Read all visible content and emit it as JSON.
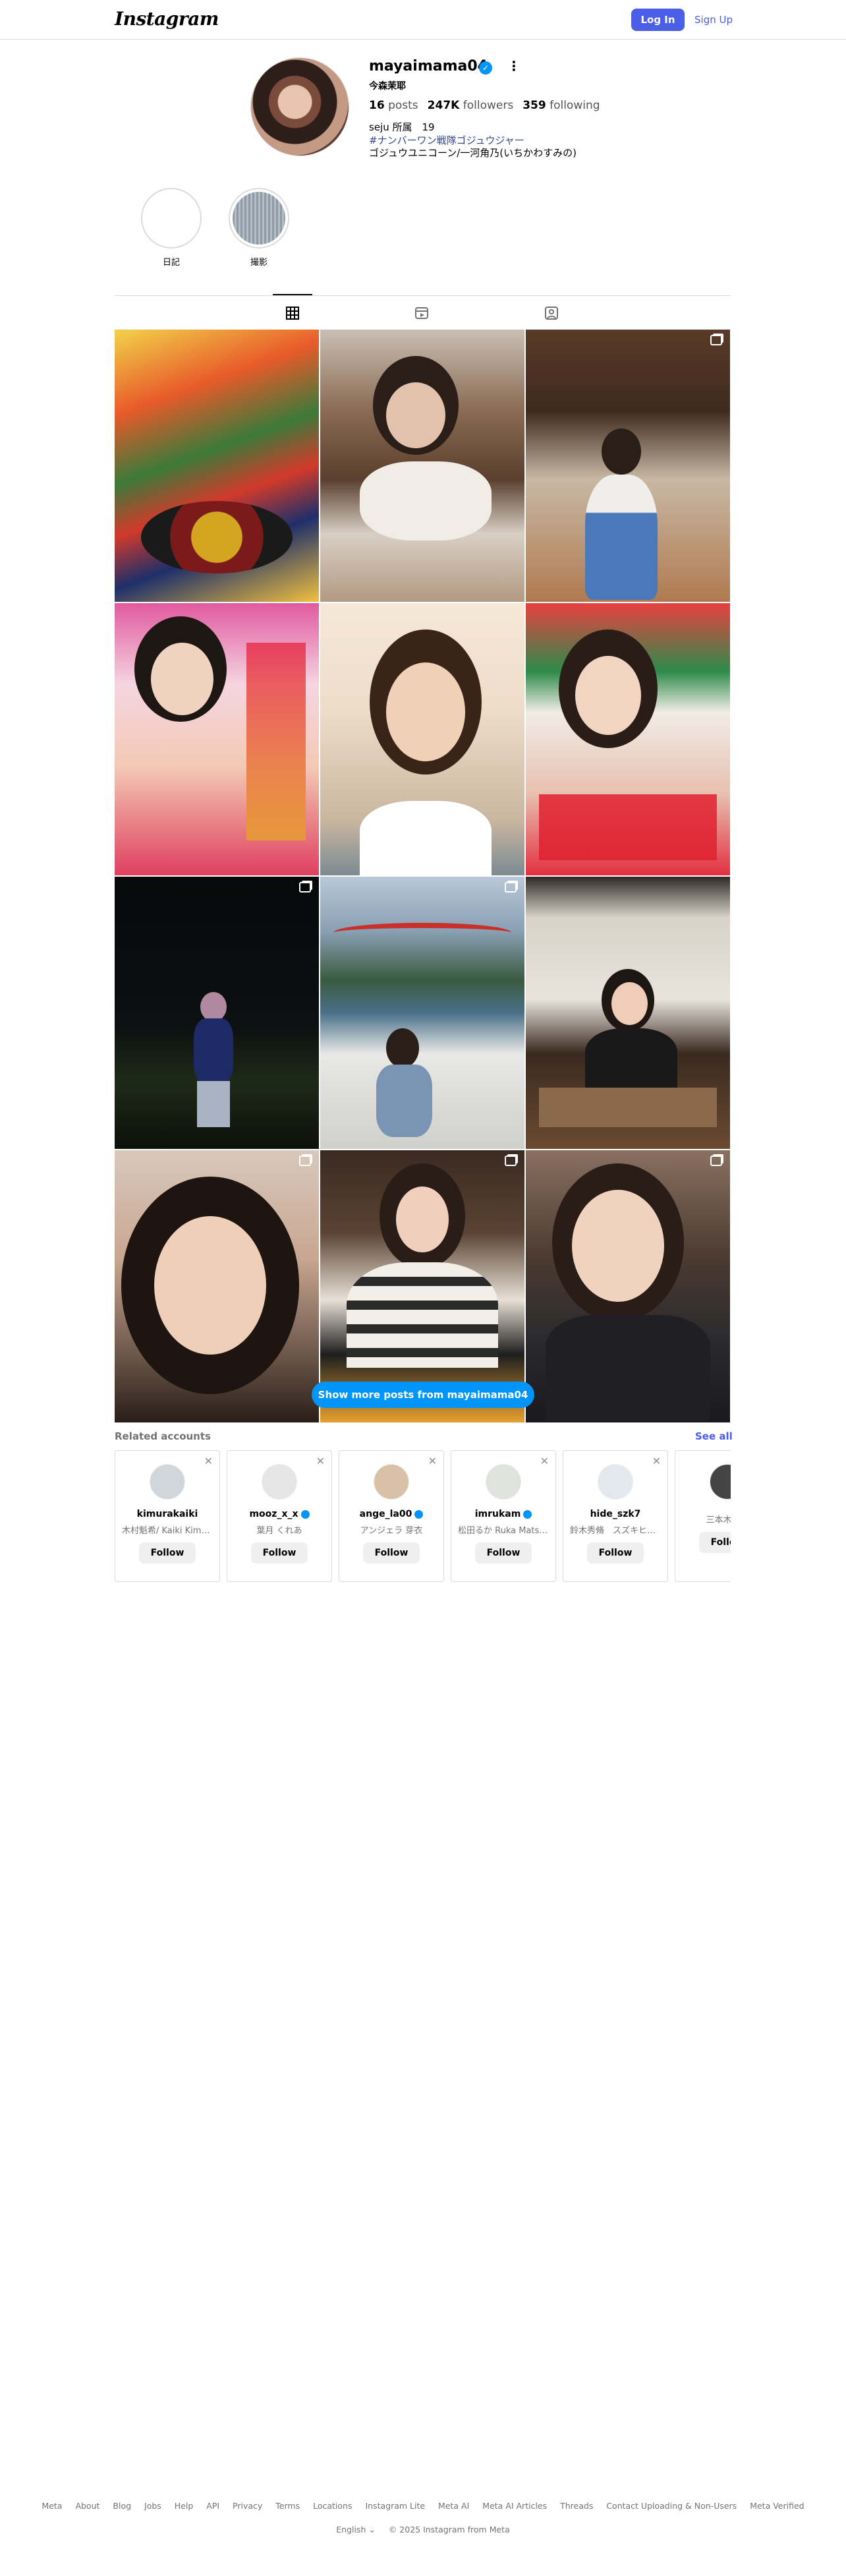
{
  "nav": {
    "logo": "Instagram",
    "login": "Log In",
    "signup": "Sign Up"
  },
  "profile": {
    "username": "mayaimama04",
    "fullname": "今森茉耶",
    "posts_count": "16",
    "posts_label": "posts",
    "followers_count": "247K",
    "followers_label": "followers",
    "following_count": "359",
    "following_label": "following",
    "bio_line1": "seju 所属　19",
    "bio_line2": "#ナンバーワン戦隊ゴジュウジャー",
    "bio_line3": "ゴジュウユニコーン/一河角乃(いちかわすみの)",
    "more_icon": "⋮",
    "verified_icon": "✓"
  },
  "highlights": [
    {
      "label": "日記",
      "color": "#ffffff"
    },
    {
      "label": "撮影",
      "color": "#9aa6b0"
    }
  ],
  "tabs": [
    "posts-tab",
    "reels-tab",
    "tagged-tab"
  ],
  "show_more": "Show more posts from mayaimama04",
  "related": {
    "title": "Related accounts",
    "see_all": "See all",
    "follow_label": "Follow",
    "accounts": [
      {
        "username": "kimurakaiki",
        "name": "木村魁希/ Kaiki Kimura",
        "verified": false,
        "avatar": "#cfd6dc"
      },
      {
        "username": "mooz_x_x",
        "name": "葉月 くれあ",
        "verified": true,
        "avatar": "#e6e6e6"
      },
      {
        "username": "ange_la00",
        "name": "アンジェラ 芽衣",
        "verified": true,
        "avatar": "#d9c1a8"
      },
      {
        "username": "imrukam",
        "name": "松田るか Ruka Matsuda",
        "verified": true,
        "avatar": "#dfe3dc"
      },
      {
        "username": "hide_szk7",
        "name": "鈴木秀脩　スズキヒデノブ",
        "verified": false,
        "avatar": "#e3e7ee"
      },
      {
        "username": "",
        "name": "三本木大輔",
        "verified": false,
        "avatar": "#444444"
      }
    ]
  },
  "footer": {
    "links": [
      "Meta",
      "About",
      "Blog",
      "Jobs",
      "Help",
      "API",
      "Privacy",
      "Terms",
      "Locations",
      "Instagram Lite",
      "Meta AI",
      "Meta AI Articles",
      "Threads",
      "Contact Uploading & Non-Users",
      "Meta Verified"
    ],
    "language": "English ⌄",
    "copyright": "© 2025 Instagram from Meta"
  },
  "colors": {
    "accent": "#0095f6",
    "login": "#4a5ee6",
    "border": "#dbdbdb",
    "muted": "#737373"
  }
}
